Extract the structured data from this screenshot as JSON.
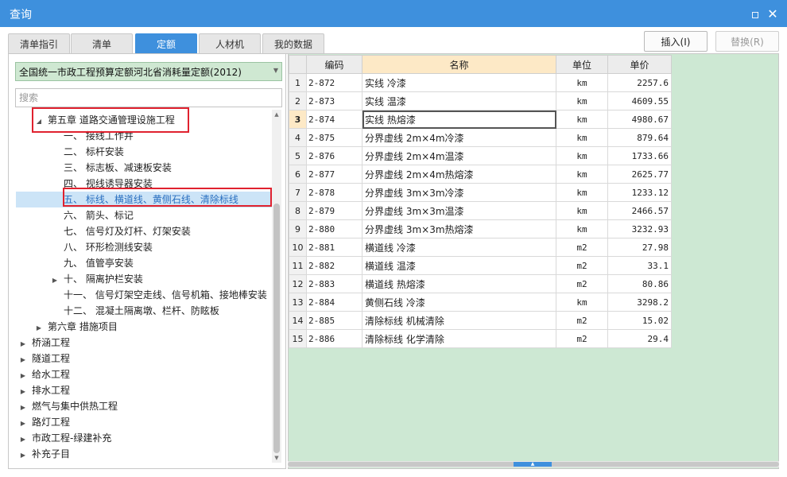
{
  "window": {
    "title": "查询",
    "restore_symbol": "▫",
    "close_symbol": "✕"
  },
  "tabs": [
    {
      "label": "清单指引",
      "active": false
    },
    {
      "label": "清单",
      "active": false
    },
    {
      "label": "定额",
      "active": true
    },
    {
      "label": "人材机",
      "active": false
    },
    {
      "label": "我的数据",
      "active": false
    }
  ],
  "toolbar": {
    "insert_label": "插入(I)",
    "replace_label": "替换(R)"
  },
  "left": {
    "quota_library": "全国统一市政工程预算定额河北省消耗量定额(2012)",
    "search_placeholder": "搜索"
  },
  "tree": [
    {
      "label": "第五章 道路交通管理设施工程",
      "level": 1,
      "expander": "◢",
      "boxed": true
    },
    {
      "label": "一、 接线工作井",
      "level": 2,
      "expander": ""
    },
    {
      "label": "二、 标杆安装",
      "level": 2,
      "expander": ""
    },
    {
      "label": "三、 标志板、减速板安装",
      "level": 2,
      "expander": ""
    },
    {
      "label": "四、 视线诱导器安装",
      "level": 2,
      "expander": ""
    },
    {
      "label": "五、 标线、横道线、黄侧石线、清除标线",
      "level": 2,
      "expander": "",
      "selected": true,
      "boxed": true
    },
    {
      "label": "六、 箭头、标记",
      "level": 2,
      "expander": ""
    },
    {
      "label": "七、 信号灯及灯杆、灯架安装",
      "level": 2,
      "expander": ""
    },
    {
      "label": "八、 环形检测线安装",
      "level": 2,
      "expander": ""
    },
    {
      "label": "九、 值管亭安装",
      "level": 2,
      "expander": ""
    },
    {
      "label": "十、 隔离护栏安装",
      "level": 2,
      "expander": "▶"
    },
    {
      "label": "十一、 信号灯架空走线、信号机箱、接地棒安装",
      "level": 2,
      "expander": ""
    },
    {
      "label": "十二、 混凝土隔离墩、栏杆、防眩板",
      "level": 2,
      "expander": ""
    },
    {
      "label": "第六章 措施项目",
      "level": 1,
      "expander": "▶"
    },
    {
      "label": "桥涵工程",
      "level": 0,
      "expander": "▶"
    },
    {
      "label": "隧道工程",
      "level": 0,
      "expander": "▶"
    },
    {
      "label": "给水工程",
      "level": 0,
      "expander": "▶"
    },
    {
      "label": "排水工程",
      "level": 0,
      "expander": "▶"
    },
    {
      "label": "燃气与集中供热工程",
      "level": 0,
      "expander": "▶"
    },
    {
      "label": "路灯工程",
      "level": 0,
      "expander": "▶"
    },
    {
      "label": "市政工程-绿建补充",
      "level": 0,
      "expander": "▶"
    },
    {
      "label": "补充子目",
      "level": 0,
      "expander": "▶"
    }
  ],
  "table": {
    "columns": [
      "",
      "编码",
      "名称",
      "单位",
      "单价"
    ],
    "rows": [
      {
        "n": "1",
        "code": "2-872",
        "name": "实线 冷漆",
        "unit": "km",
        "price": "2257.6"
      },
      {
        "n": "2",
        "code": "2-873",
        "name": "实线 温漆",
        "unit": "km",
        "price": "4609.55"
      },
      {
        "n": "3",
        "code": "2-874",
        "name": "实线 热熔漆",
        "unit": "km",
        "price": "4980.67",
        "active": true
      },
      {
        "n": "4",
        "code": "2-875",
        "name": "分界虚线 2m×4m冷漆",
        "unit": "km",
        "price": "879.64"
      },
      {
        "n": "5",
        "code": "2-876",
        "name": "分界虚线 2m×4m温漆",
        "unit": "km",
        "price": "1733.66"
      },
      {
        "n": "6",
        "code": "2-877",
        "name": "分界虚线 2m×4m热熔漆",
        "unit": "km",
        "price": "2625.77"
      },
      {
        "n": "7",
        "code": "2-878",
        "name": "分界虚线 3m×3m冷漆",
        "unit": "km",
        "price": "1233.12"
      },
      {
        "n": "8",
        "code": "2-879",
        "name": "分界虚线 3m×3m温漆",
        "unit": "km",
        "price": "2466.57"
      },
      {
        "n": "9",
        "code": "2-880",
        "name": "分界虚线 3m×3m热熔漆",
        "unit": "km",
        "price": "3232.93"
      },
      {
        "n": "10",
        "code": "2-881",
        "name": "横道线 冷漆",
        "unit": "m2",
        "price": "27.98"
      },
      {
        "n": "11",
        "code": "2-882",
        "name": "横道线 温漆",
        "unit": "m2",
        "price": "33.1"
      },
      {
        "n": "12",
        "code": "2-883",
        "name": "横道线 热熔漆",
        "unit": "m2",
        "price": "80.86"
      },
      {
        "n": "13",
        "code": "2-884",
        "name": "黄侧石线 冷漆",
        "unit": "km",
        "price": "3298.2"
      },
      {
        "n": "14",
        "code": "2-885",
        "name": "清除标线 机械清除",
        "unit": "m2",
        "price": "15.02"
      },
      {
        "n": "15",
        "code": "2-886",
        "name": "清除标线 化学清除",
        "unit": "m2",
        "price": "29.4"
      }
    ]
  },
  "colors": {
    "accent": "#3e90dd",
    "highlight": "#fde9c6",
    "grid_background": "#cde8d3",
    "annotation": "#e0222f"
  }
}
